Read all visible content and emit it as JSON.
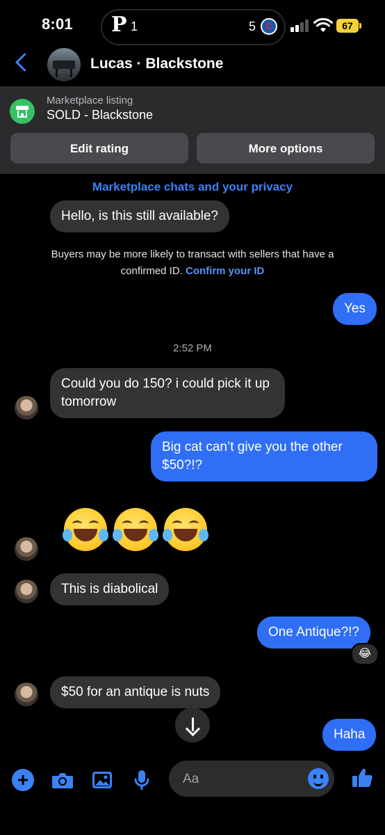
{
  "status_bar": {
    "time": "8:01",
    "island_left": "1",
    "island_right": "5",
    "battery": "67"
  },
  "header": {
    "contact_name": "Lucas · Blackstone"
  },
  "marketplace": {
    "label": "Marketplace listing",
    "title": "SOLD - Blackstone",
    "edit_rating": "Edit rating",
    "more_options": "More options"
  },
  "chat": {
    "privacy_link": "Marketplace chats and your privacy",
    "notice_text": "Buyers may be more likely to transact with sellers that have a confirmed ID.",
    "notice_link": "Confirm your ID",
    "timestamp": "2:52 PM",
    "messages": [
      {
        "dir": "in",
        "text": "Hello, is this still available?"
      },
      {
        "dir": "out",
        "text": "Yes"
      },
      {
        "dir": "in",
        "text": "Could you do 150? i could pick it up tomorrow"
      },
      {
        "dir": "out",
        "text": "Big cat can’t give you the other $50?!?"
      },
      {
        "dir": "in",
        "text": "This is diabolical"
      },
      {
        "dir": "out",
        "text": "One Antique?!?"
      },
      {
        "dir": "in",
        "text": "$50 for an antique is nuts"
      },
      {
        "dir": "out",
        "text": "Haha"
      }
    ],
    "emoji_message_count": 3,
    "reaction": "😂"
  },
  "composer": {
    "placeholder": "Aa"
  },
  "colors": {
    "accent": "#3b82f6",
    "outgoing_bubble": "#2f6ef5",
    "incoming_bubble": "#333335",
    "panel": "#2b2b2d",
    "marketplace_icon": "#35c265"
  }
}
